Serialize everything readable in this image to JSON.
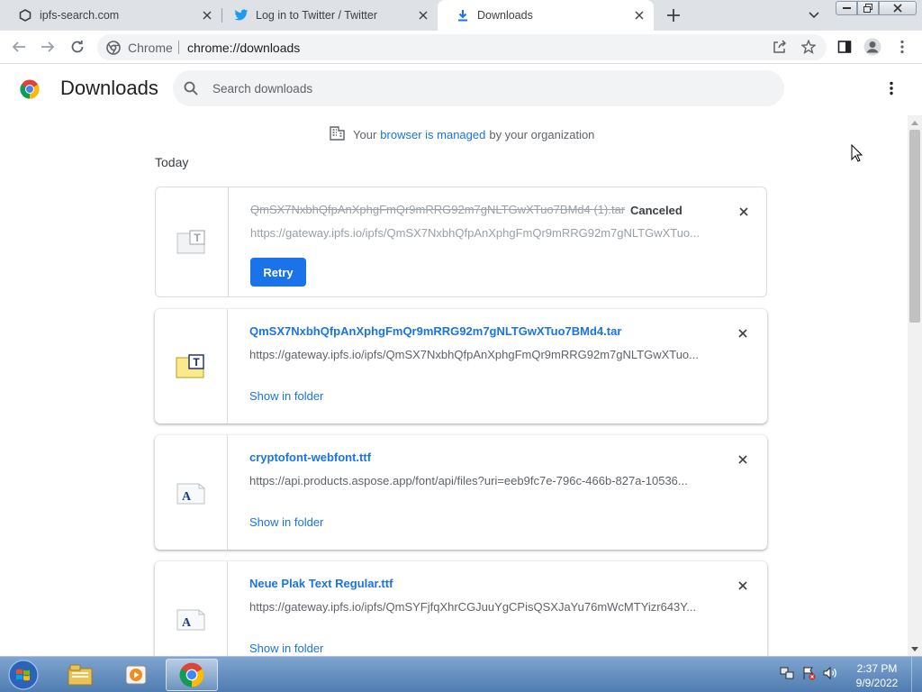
{
  "tabs": [
    {
      "title": "ipfs-search.com",
      "icon": "ipfs-icon"
    },
    {
      "title": "Log in to Twitter / Twitter",
      "icon": "twitter-icon"
    },
    {
      "title": "Downloads",
      "icon": "download-icon",
      "active": true
    }
  ],
  "toolbar": {
    "scheme_label": "Chrome",
    "url": "chrome://downloads"
  },
  "downloads_page": {
    "title": "Downloads",
    "search_placeholder": "Search downloads",
    "managed_notice": {
      "prefix": "Your",
      "link": "browser is managed",
      "suffix": "by your organization"
    },
    "date_group": "Today",
    "items": [
      {
        "filename": "QmSX7NxbhQfpAnXphgFmQr9mRRG92m7gNLTGwXTuo7BMd4 (1).tar",
        "status": "Canceled",
        "url": "https://gateway.ipfs.io/ipfs/QmSX7NxbhQfpAnXphgFmQr9mRRG92m7gNLTGwXTuo...",
        "action": "Retry",
        "icon": "tar-file-icon"
      },
      {
        "filename": "QmSX7NxbhQfpAnXphgFmQr9mRRG92m7gNLTGwXTuo7BMd4.tar",
        "url": "https://gateway.ipfs.io/ipfs/QmSX7NxbhQfpAnXphgFmQr9mRRG92m7gNLTGwXTuo...",
        "action": "Show in folder",
        "icon": "tar-file-icon"
      },
      {
        "filename": "cryptofont-webfont.ttf",
        "url": "https://api.products.aspose.app/font/api/files?uri=eeb9fc7e-796c-466b-827a-10536...",
        "action": "Show in folder",
        "icon": "font-file-icon"
      },
      {
        "filename": "Neue Plak Text Regular.ttf",
        "url": "https://gateway.ipfs.io/ipfs/QmSYFjfqXhrCGJuuYgCPisQSXJaYu76mWcMTYizr643Y...",
        "action": "Show in folder",
        "icon": "font-file-icon"
      }
    ]
  },
  "taskbar": {
    "time": "2:37 PM",
    "date": "9/9/2022"
  },
  "colors": {
    "accent": "#1a73e8",
    "tabstrip": "#dee1e6"
  }
}
